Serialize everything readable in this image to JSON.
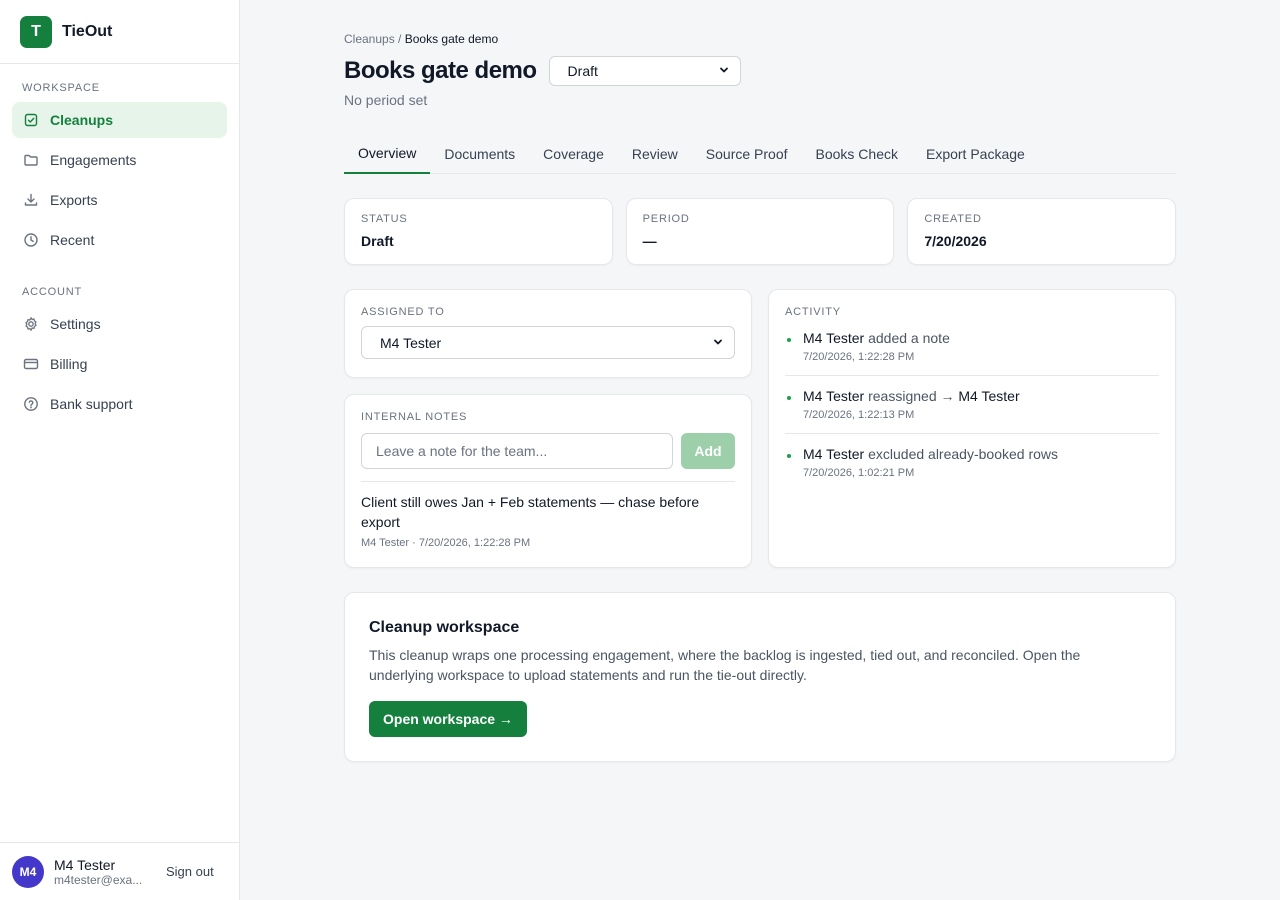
{
  "app": {
    "logo_letter": "T",
    "name": "TieOut",
    "brand_color": "#15803d"
  },
  "sidebar": {
    "workspace_label": "WORKSPACE",
    "workspace_items": [
      {
        "label": "Cleanups",
        "icon": "clipboard-check-icon",
        "active": true
      },
      {
        "label": "Engagements",
        "icon": "folder-icon"
      },
      {
        "label": "Exports",
        "icon": "download-icon"
      },
      {
        "label": "Recent",
        "icon": "clock-icon"
      }
    ],
    "account_label": "ACCOUNT",
    "account_items": [
      {
        "label": "Settings",
        "icon": "gear-icon"
      },
      {
        "label": "Billing",
        "icon": "credit-card-icon"
      },
      {
        "label": "Bank support",
        "icon": "help-circle-icon"
      }
    ]
  },
  "user": {
    "initials": "M4",
    "name": "M4 Tester",
    "email": "m4tester@exa...",
    "signout_label": "Sign out"
  },
  "breadcrumb": {
    "parent": "Cleanups",
    "separator": "/",
    "current": "Books gate demo"
  },
  "page": {
    "title": "Books gate demo",
    "status_value": "Draft",
    "subtitle": "No period set"
  },
  "tabs": [
    "Overview",
    "Documents",
    "Coverage",
    "Review",
    "Source Proof",
    "Books Check",
    "Export Package"
  ],
  "stats": [
    {
      "label": "STATUS",
      "value": "Draft"
    },
    {
      "label": "PERIOD",
      "value": "—"
    },
    {
      "label": "CREATED",
      "value": "7/20/2026"
    }
  ],
  "assigned": {
    "label": "ASSIGNED TO",
    "value": "M4 Tester"
  },
  "notes": {
    "label": "INTERNAL NOTES",
    "placeholder": "Leave a note for the team...",
    "add_label": "Add",
    "items": [
      {
        "text": "Client still owes Jan + Feb statements — chase before export",
        "meta": "M4 Tester · 7/20/2026, 1:22:28 PM"
      }
    ]
  },
  "activity": {
    "label": "ACTIVITY",
    "items": [
      {
        "who": "M4 Tester",
        "action": "added a note",
        "target": "",
        "time": "7/20/2026, 1:22:28 PM"
      },
      {
        "who": "M4 Tester",
        "action": "reassigned →",
        "target": "M4 Tester",
        "time": "7/20/2026, 1:22:13 PM"
      },
      {
        "who": "M4 Tester",
        "action": "excluded already-booked rows",
        "target": "",
        "time": "7/20/2026, 1:02:21 PM"
      }
    ]
  },
  "workspace": {
    "title": "Cleanup workspace",
    "description": "This cleanup wraps one processing engagement, where the backlog is ingested, tied out, and reconciled. Open the underlying workspace to upload statements and run the tie-out directly.",
    "button_label": "Open workspace →"
  }
}
